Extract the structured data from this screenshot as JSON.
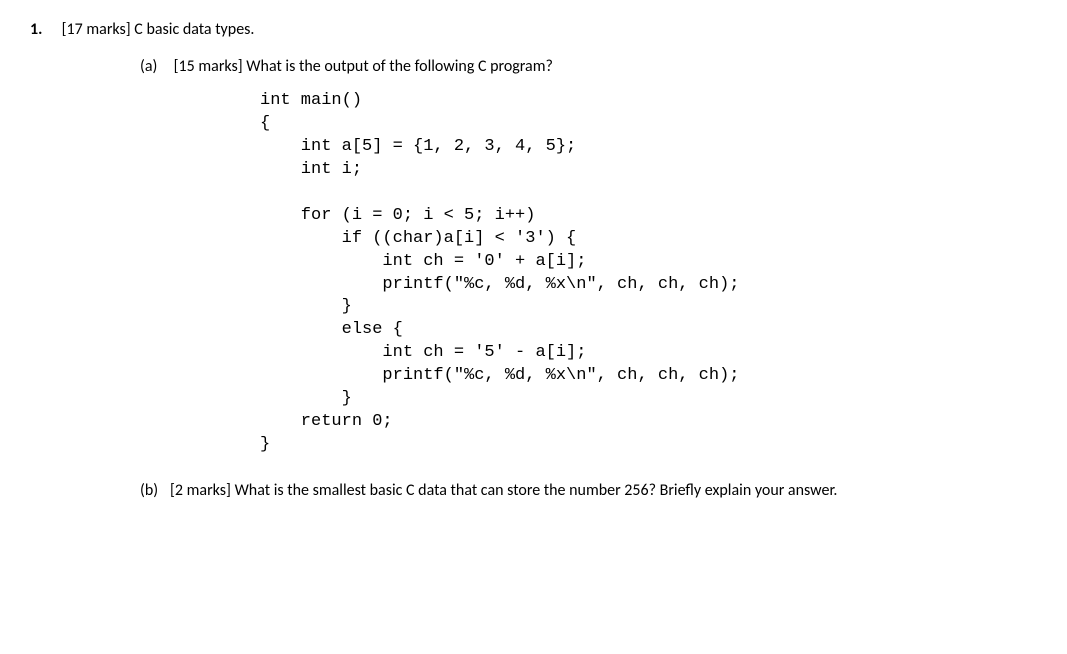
{
  "question": {
    "number": "1.",
    "title": "[17 marks] C basic data types."
  },
  "partA": {
    "label": "(a)",
    "text": "[15 marks] What is the output of the following C program?",
    "code": "int main()\n{\n    int a[5] = {1, 2, 3, 4, 5};\n    int i;\n\n    for (i = 0; i < 5; i++)\n        if ((char)a[i] < '3') {\n            int ch = '0' + a[i];\n            printf(\"%c, %d, %x\\n\", ch, ch, ch);\n        }\n        else {\n            int ch = '5' - a[i];\n            printf(\"%c, %d, %x\\n\", ch, ch, ch);\n        }\n    return 0;\n}"
  },
  "partB": {
    "label": "(b)",
    "text": "[2 marks] What is the smallest basic C data that can store the number 256? Briefly explain your answer."
  }
}
